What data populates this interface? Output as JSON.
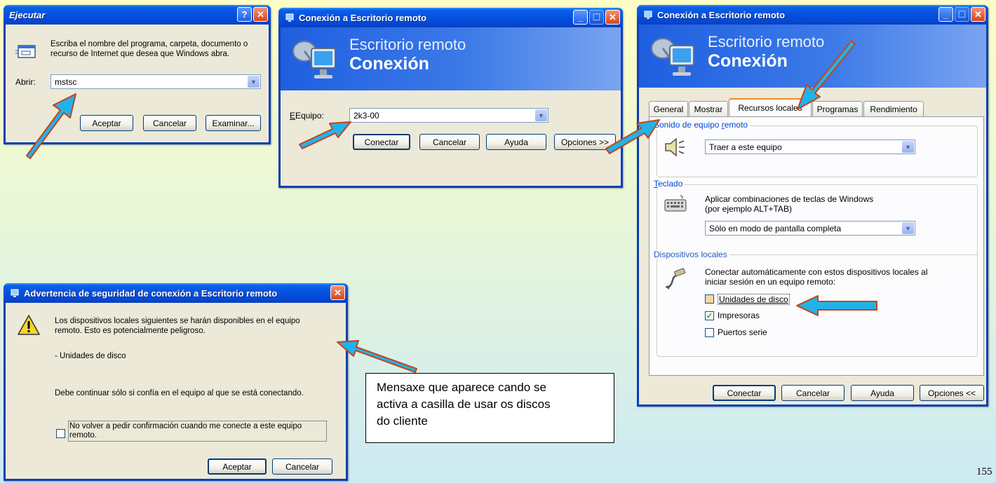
{
  "run_dialog": {
    "title": "Ejecutar",
    "description": "Escriba el nombre del programa, carpeta, documento o recurso de Internet que desea que Windows abra.",
    "open_label": "Abrir:",
    "open_value": "mstsc",
    "ok": "Aceptar",
    "cancel": "Cancelar",
    "browse": "Examinar..."
  },
  "rdc_small": {
    "title": "Conexión a Escritorio remoto",
    "banner_line1": "Escritorio remoto",
    "banner_line2": "Conexión",
    "computer_label": "Equipo:",
    "computer_value": "2k3-00",
    "connect": "Conectar",
    "cancel": "Cancelar",
    "help": "Ayuda",
    "options": "Opciones >>"
  },
  "rdc_large": {
    "title": "Conexión a Escritorio remoto",
    "banner_line1": "Escritorio remoto",
    "banner_line2": "Conexión",
    "tabs": [
      "General",
      "Mostrar",
      "Recursos locales",
      "Programas",
      "Rendimiento"
    ],
    "active_tab": "Recursos locales",
    "sound_group": "Sonido de equipo remoto",
    "sound_value": "Traer a este equipo",
    "keyboard_group": "Teclado",
    "keyboard_desc_1": "Aplicar combinaciones de teclas de Windows",
    "keyboard_desc_2": "(por ejemplo ALT+TAB)",
    "keyboard_value": "Sólo en modo de pantalla completa",
    "devices_group": "Dispositivos locales",
    "devices_desc_1": "Conectar automáticamente con estos dispositivos locales al",
    "devices_desc_2": "iniciar sesión en un equipo remoto:",
    "devices": [
      {
        "label": "Unidades de disco",
        "checked": false
      },
      {
        "label": "Impresoras",
        "checked": true
      },
      {
        "label": "Puertos serie",
        "checked": false
      }
    ],
    "connect": "Conectar",
    "cancel": "Cancelar",
    "help": "Ayuda",
    "options": "Opciones <<"
  },
  "warning_dialog": {
    "title": "Advertencia de seguridad de conexión a Escritorio remoto",
    "text_1": "Los dispositivos locales siguientes se harán disponibles en el equipo",
    "text_2": "remoto. Esto es potencialmente peligroso.",
    "device_item": "- Unidades de disco",
    "continue_text": "Debe continuar sólo si confía en el equipo al que se está conectando.",
    "dont_ask_1": "No volver a pedir confirmación cuando me conecte a este equipo",
    "dont_ask_2": "remoto.",
    "ok": "Aceptar",
    "cancel": "Cancelar"
  },
  "callout": {
    "line1": "Mensaxe que aparece cando se",
    "line2": "activa a casilla de usar os discos",
    "line3": "do cliente"
  },
  "page_number": "155",
  "colors": {
    "titlebar": "#0551e0",
    "window_bg": "#ece9d8",
    "arrow_fill": "#22b2ea",
    "arrow_stroke": "#c4441d",
    "group_title": "#0046d5"
  }
}
